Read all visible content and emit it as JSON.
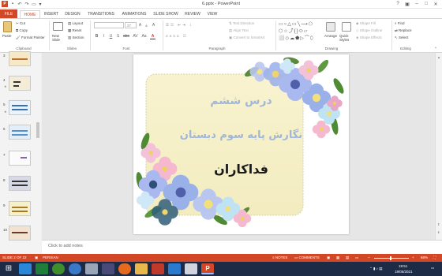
{
  "titlebar": {
    "title": "6.pptx - PowerPoint",
    "help": "?"
  },
  "tabs": [
    "FILE",
    "HOME",
    "INSERT",
    "DESIGN",
    "TRANSITIONS",
    "ANIMATIONS",
    "SLIDE SHOW",
    "REVIEW",
    "VIEW"
  ],
  "active_tab": "HOME",
  "ribbon": {
    "clipboard": {
      "paste": "Paste",
      "cut": "Cut",
      "copy": "Copy",
      "format_painter": "Format Painter",
      "label": "Clipboard"
    },
    "slides": {
      "new_slide": "New Slide",
      "layout": "Layout",
      "reset": "Reset",
      "section": "Section",
      "label": "Slides"
    },
    "font": {
      "font_name": "",
      "font_size": "27",
      "bold": "B",
      "italic": "I",
      "underline": "U",
      "shadow": "S",
      "strike": "abc",
      "spacing": "AV",
      "case": "Aa",
      "grow": "A",
      "shrink": "A",
      "clear": "A",
      "color": "A",
      "label": "Font"
    },
    "paragraph": {
      "text_direction": "Text Direction",
      "align_text": "Align Text",
      "convert": "Convert to SmartArt",
      "label": "Paragraph"
    },
    "drawing": {
      "arrange": "Arrange",
      "quick_styles": "Quick Styles",
      "shape_fill": "Shape Fill",
      "shape_outline": "Shape Outline",
      "shape_effects": "Shape Effects",
      "label": "Drawing"
    },
    "editing": {
      "find": "Find",
      "replace": "Replace",
      "select": "Select",
      "label": "Editing"
    }
  },
  "slides_pane": {
    "numbers": [
      "3",
      "4",
      "5",
      "6",
      "7",
      "8",
      "9",
      "10"
    ]
  },
  "slide": {
    "line1": "درس ششم",
    "line2": "نگارش پایه سوم دبستان",
    "line3": "فداکاران"
  },
  "notes": {
    "placeholder": "Click to add notes"
  },
  "status": {
    "slide_info": "SLIDE 2 OF 22",
    "language": "PERSIAN",
    "notes_btn": "NOTES",
    "comments_btn": "COMMENTS",
    "zoom": "68%"
  },
  "taskbar": {
    "time": "19:51",
    "date": "19/05/2021"
  },
  "colors": {
    "accent": "#d24726",
    "taskbar": "#1d2b46",
    "slide_title": "#9ab4d6",
    "slide_main": "#1a1a1a"
  }
}
